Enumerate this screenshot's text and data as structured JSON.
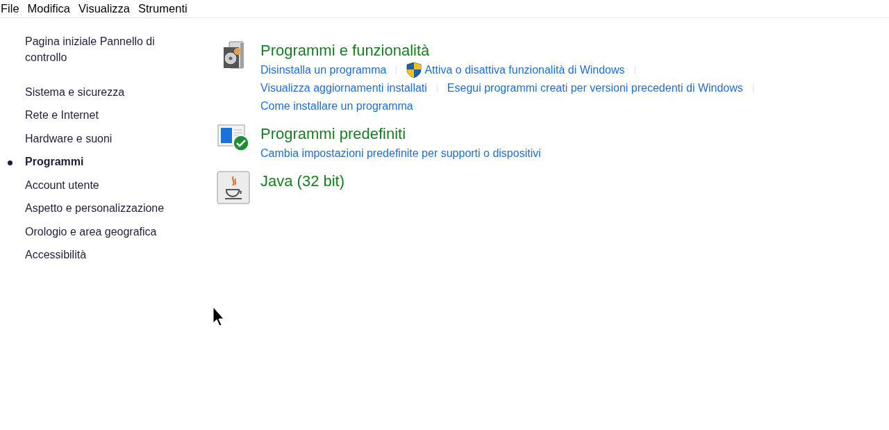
{
  "menu": [
    "File",
    "Modifica",
    "Visualizza",
    "Strumenti"
  ],
  "sidebar": {
    "home": "Pagina iniziale Pannello di controllo",
    "items": [
      {
        "label": "Sistema e sicurezza",
        "selected": false
      },
      {
        "label": "Rete e Internet",
        "selected": false
      },
      {
        "label": "Hardware e suoni",
        "selected": false
      },
      {
        "label": "Programmi",
        "selected": true
      },
      {
        "label": "Account utente",
        "selected": false
      },
      {
        "label": "Aspetto e personalizzazione",
        "selected": false
      },
      {
        "label": "Orologio e area geografica",
        "selected": false
      },
      {
        "label": "Accessibilità",
        "selected": false
      }
    ]
  },
  "sections": [
    {
      "kind": "programs",
      "title": "Programmi e funzionalità",
      "rows": [
        [
          {
            "label": "Disinstalla un programma",
            "admin": false
          },
          {
            "label": "Attiva o disattiva funzionalità di Windows",
            "admin": true
          }
        ],
        [
          {
            "label": "Visualizza aggiornamenti installati",
            "admin": false
          },
          {
            "label": "Esegui programmi creati per versioni precedenti di Windows",
            "admin": false
          }
        ],
        [
          {
            "label": "Come installare un programma",
            "admin": false
          }
        ]
      ]
    },
    {
      "kind": "defaults",
      "title": "Programmi predefiniti",
      "rows": [
        [
          {
            "label": "Cambia impostazioni predefinite per supporti o dispositivi",
            "admin": false
          }
        ]
      ]
    },
    {
      "kind": "java",
      "title": "Java (32 bit)"
    }
  ]
}
